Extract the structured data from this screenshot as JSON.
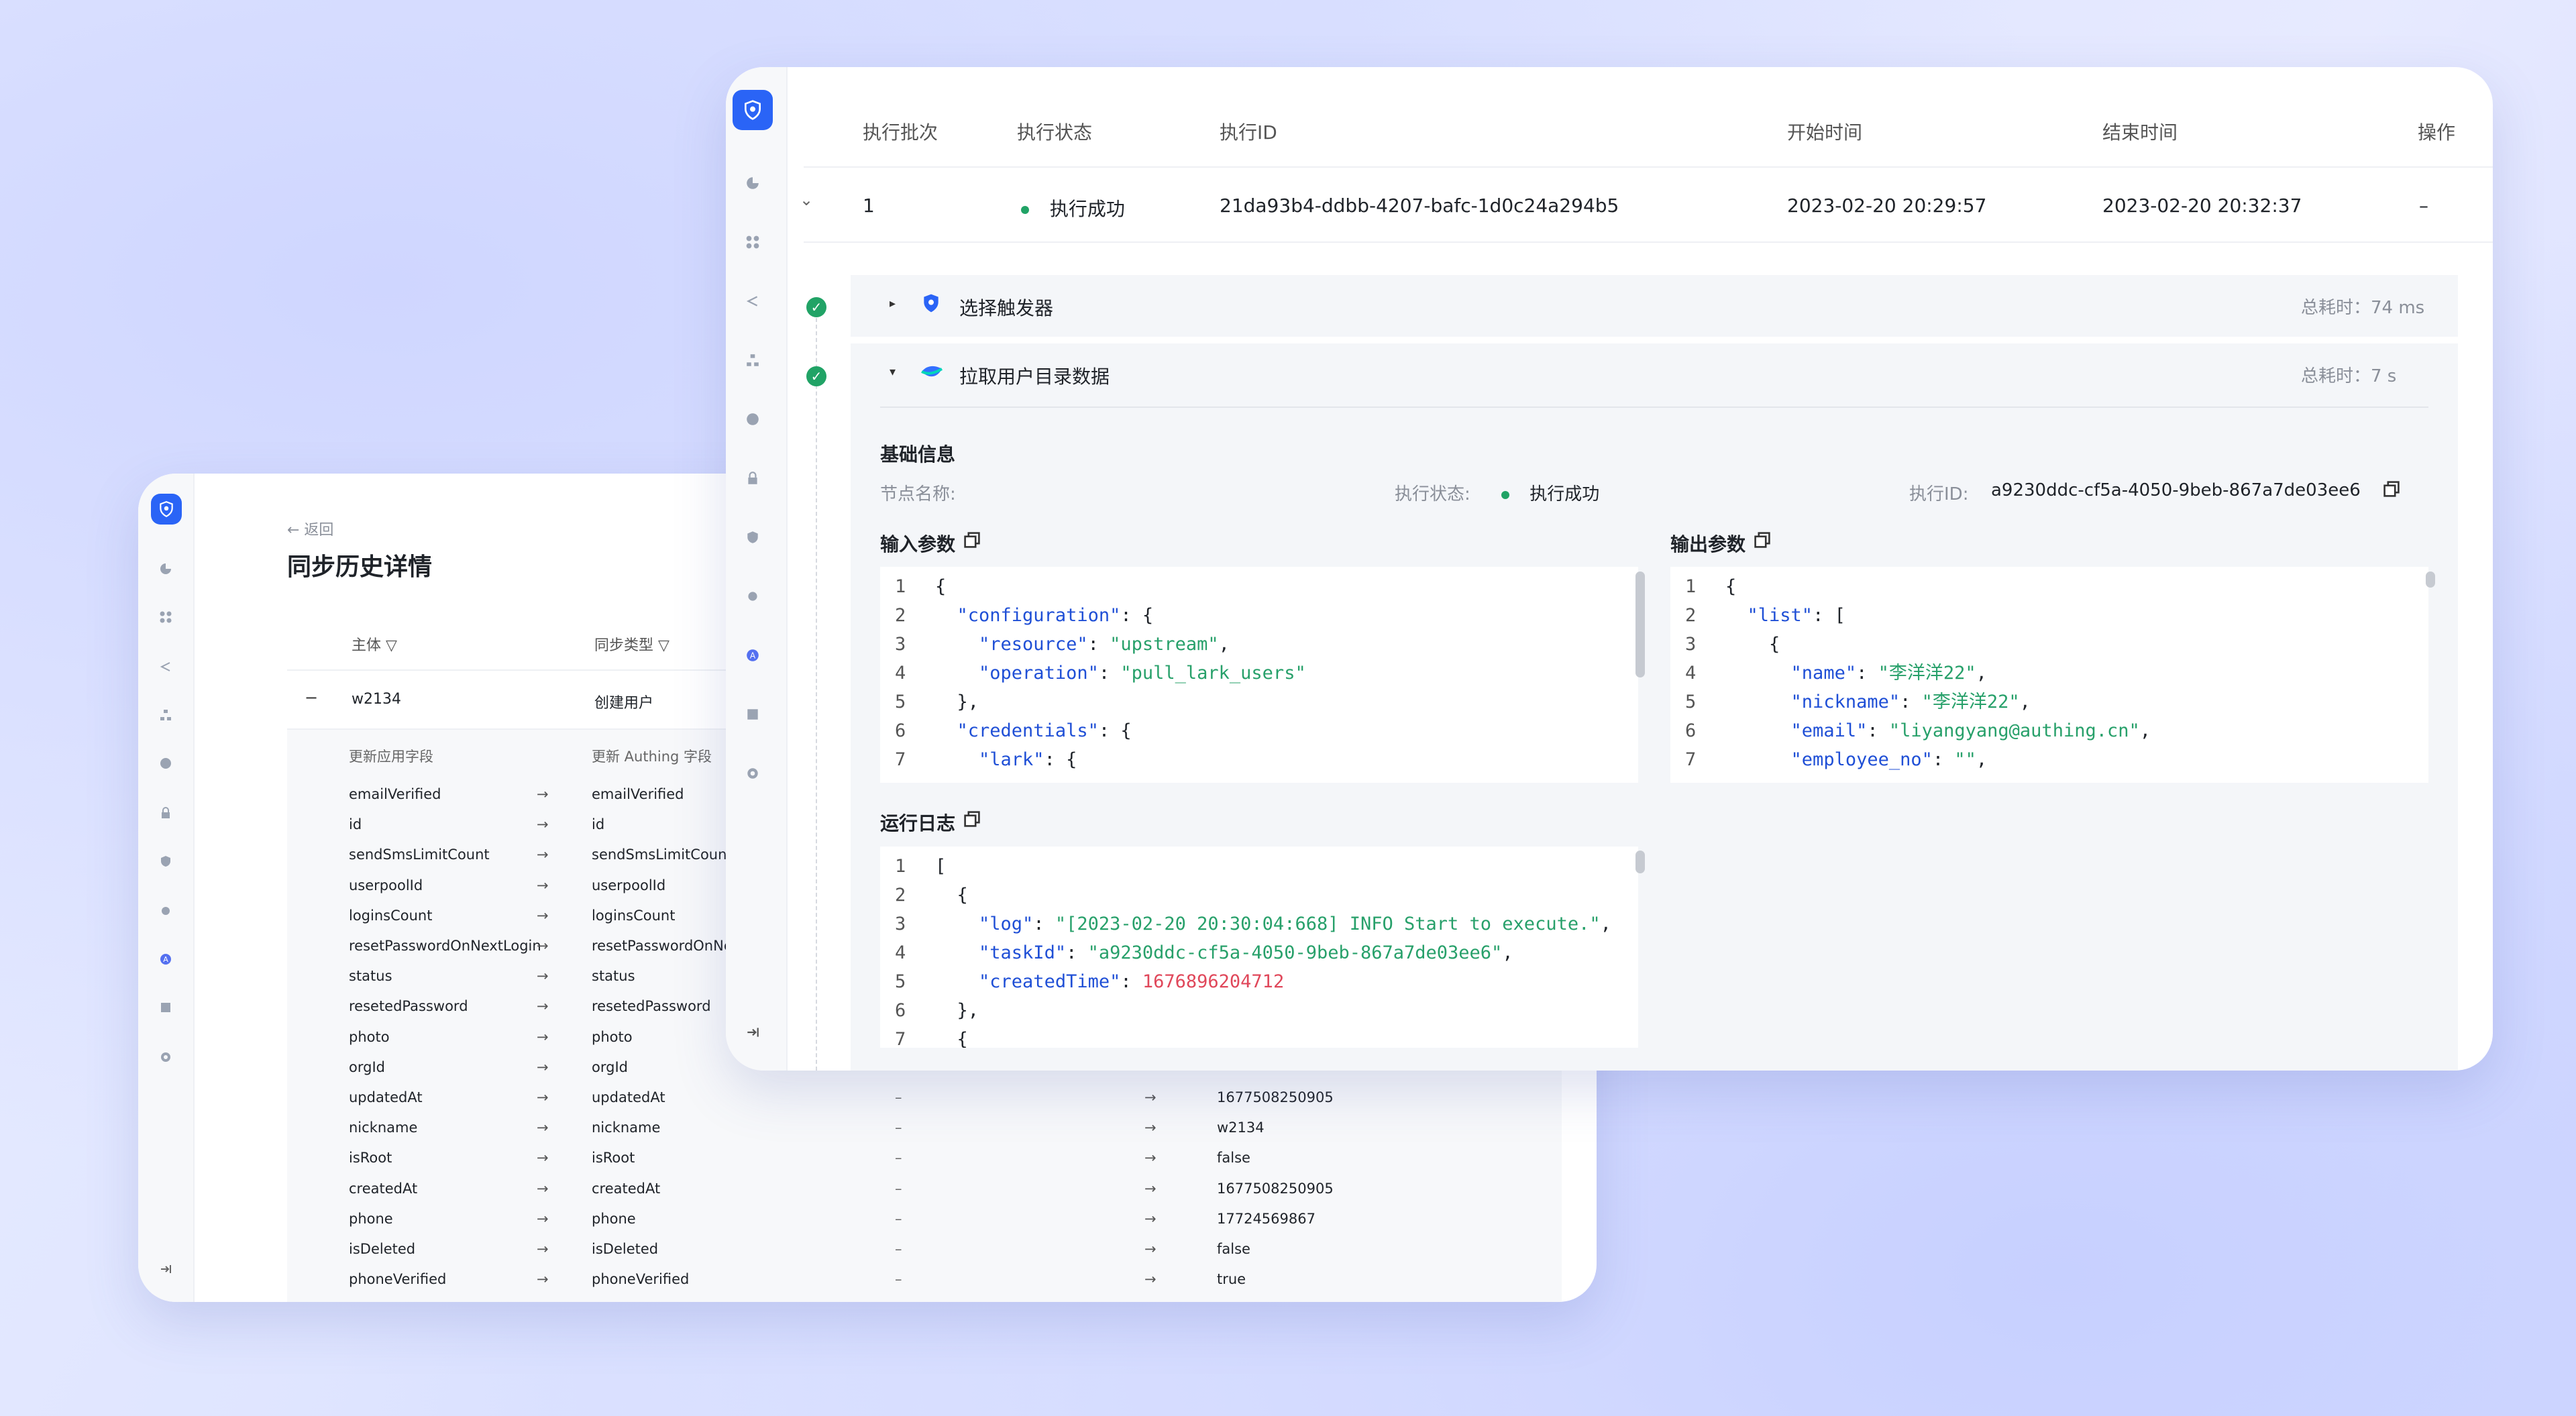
{
  "left_window": {
    "back_label": "← 返回",
    "title": "同步历史详情",
    "columns": [
      "主体 ▽",
      "同步类型 ▽"
    ],
    "row": {
      "toggle": "−",
      "subject": "w2134",
      "type": "创建用户"
    },
    "sub_headers": [
      "更新应用字段",
      "更新 Authing 字段"
    ],
    "fields": [
      {
        "app": "emailVerified",
        "authing": "emailVerified",
        "old": "",
        "new": ""
      },
      {
        "app": "id",
        "authing": "id",
        "old": "",
        "new": ""
      },
      {
        "app": "sendSmsLimitCount",
        "authing": "sendSmsLimitCount",
        "old": "",
        "new": ""
      },
      {
        "app": "userpoolId",
        "authing": "userpoolId",
        "old": "",
        "new": ""
      },
      {
        "app": "loginsCount",
        "authing": "loginsCount",
        "old": "",
        "new": ""
      },
      {
        "app": "resetPasswordOnNextLogin",
        "authing": "resetPasswordOnNe",
        "old": "",
        "new": ""
      },
      {
        "app": "status",
        "authing": "status",
        "old": "",
        "new": ""
      },
      {
        "app": "resetedPassword",
        "authing": "resetedPassword",
        "old": "",
        "new": ""
      },
      {
        "app": "photo",
        "authing": "photo",
        "old": "",
        "new": ""
      },
      {
        "app": "orgId",
        "authing": "orgId",
        "old": "",
        "new": ""
      },
      {
        "app": "updatedAt",
        "authing": "updatedAt",
        "old": "–",
        "new": "1677508250905"
      },
      {
        "app": "nickname",
        "authing": "nickname",
        "old": "–",
        "new": "w2134"
      },
      {
        "app": "isRoot",
        "authing": "isRoot",
        "old": "–",
        "new": "false"
      },
      {
        "app": "createdAt",
        "authing": "createdAt",
        "old": "–",
        "new": "1677508250905"
      },
      {
        "app": "phone",
        "authing": "phone",
        "old": "–",
        "new": "17724569867"
      },
      {
        "app": "isDeleted",
        "authing": "isDeleted",
        "old": "–",
        "new": "false"
      },
      {
        "app": "phoneVerified",
        "authing": "phoneVerified",
        "old": "–",
        "new": "true"
      }
    ]
  },
  "right_window": {
    "table_headers": [
      "执行批次",
      "执行状态",
      "执行ID",
      "开始时间",
      "结束时间",
      "操作"
    ],
    "row": {
      "batch": "1",
      "status": "执行成功",
      "exec_id": "21da93b4-ddbb-4207-bafc-1d0c24a294b5",
      "start": "2023-02-20 20:29:57",
      "end": "2023-02-20 20:32:37",
      "action": "–"
    },
    "step1": {
      "name": "选择触发器",
      "duration": "总耗时：74 ms"
    },
    "step2": {
      "name": "拉取用户目录数据",
      "duration": "总耗时：7 s"
    },
    "basic_info": {
      "title": "基础信息",
      "node_name_label": "节点名称:",
      "status_label": "执行状态:",
      "status_value": "执行成功",
      "exec_id_label": "执行ID:",
      "exec_id_value": "a9230ddc-cf5a-4050-9beb-867a7de03ee6"
    },
    "input_title": "输入参数",
    "output_title": "输出参数",
    "log_title": "运行日志",
    "colors": {
      "accent": "#2a64f6",
      "success": "#21a366"
    }
  }
}
